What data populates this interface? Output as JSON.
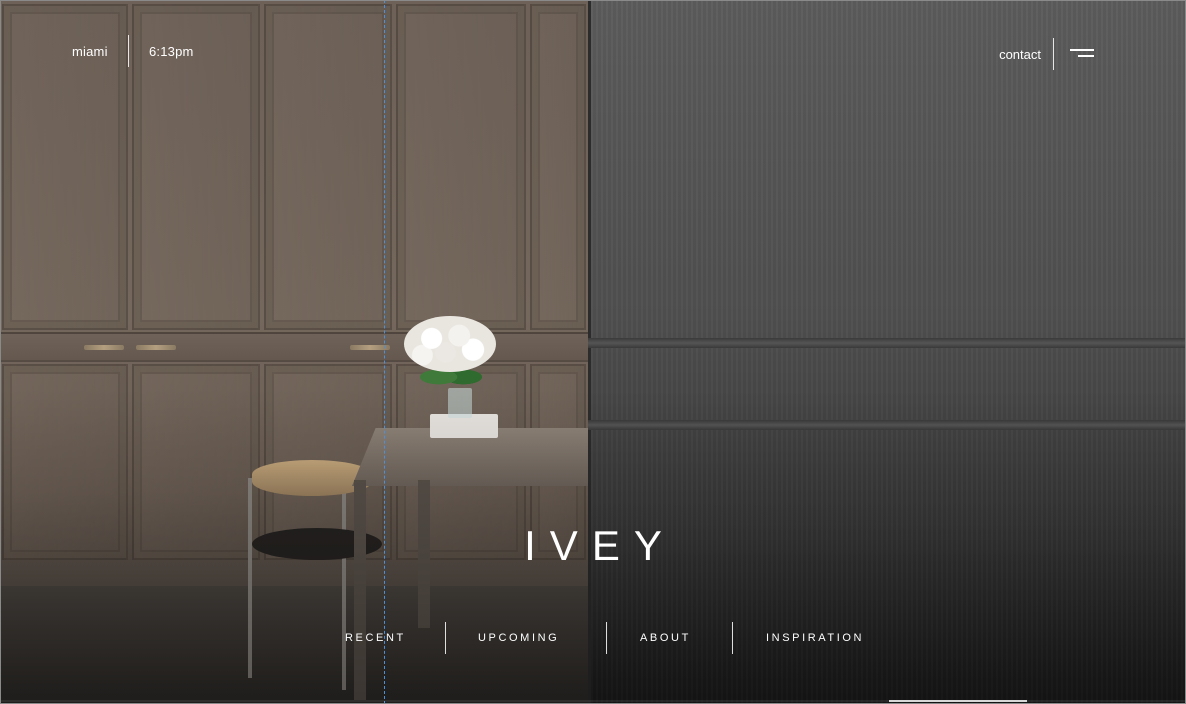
{
  "header": {
    "city": "miami",
    "time": "6:13pm",
    "contact_label": "contact",
    "menu_icon": "hamburger-menu-icon"
  },
  "brand": {
    "logo_text": "IVEY"
  },
  "nav": {
    "items": [
      {
        "label": "RECENT"
      },
      {
        "label": "UPCOMING"
      },
      {
        "label": "ABOUT"
      },
      {
        "label": "INSPIRATION"
      }
    ]
  },
  "colors": {
    "text": "#ffffff",
    "guide_line": "#4f8fd6",
    "dark_panel": "#4f4f4f",
    "wood_panel": "#74675c"
  }
}
